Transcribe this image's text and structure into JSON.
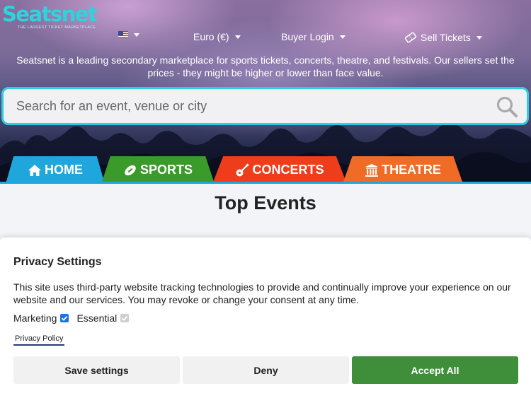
{
  "header": {
    "logo_text": "Seatsnet",
    "logo_tagline": "THE LARGEST TICKET MARKETPLACE",
    "nav": {
      "flag_icon": "us-flag-icon",
      "currency": "Euro (€)",
      "buyer_login": "Buyer Login",
      "sell_tickets": "Sell Tickets"
    },
    "intro_text": "Seatsnet is a leading secondary marketplace for sports tickets, concerts, theatre, and festivals. Our sellers set the prices - they might be higher or lower than face value."
  },
  "search": {
    "placeholder": "Search for an event, venue or city",
    "icon": "search-icon"
  },
  "tabs": [
    {
      "label": "HOME",
      "icon": "home-icon",
      "color": "#1fa6dc"
    },
    {
      "label": "SPORTS",
      "icon": "football-icon",
      "color": "#3a9a2a"
    },
    {
      "label": "CONCERTS",
      "icon": "guitar-icon",
      "color": "#ee3d1a"
    },
    {
      "label": "THEATRE",
      "icon": "theatre-icon",
      "color": "#f06b26"
    }
  ],
  "main": {
    "section_title": "Top Events"
  },
  "privacy": {
    "title": "Privacy Settings",
    "text": "This site uses third-party website tracking technologies to provide and continually improve your experience on our website and our services. You may revoke or change your consent at any time.",
    "marketing_label": "Marketing",
    "marketing_checked": true,
    "essential_label": "Essential",
    "essential_checked": true,
    "policy_link": "Privacy Policy",
    "buttons": {
      "save": "Save settings",
      "deny": "Deny",
      "accept": "Accept All"
    },
    "accept_color": "#3f8f3a"
  }
}
